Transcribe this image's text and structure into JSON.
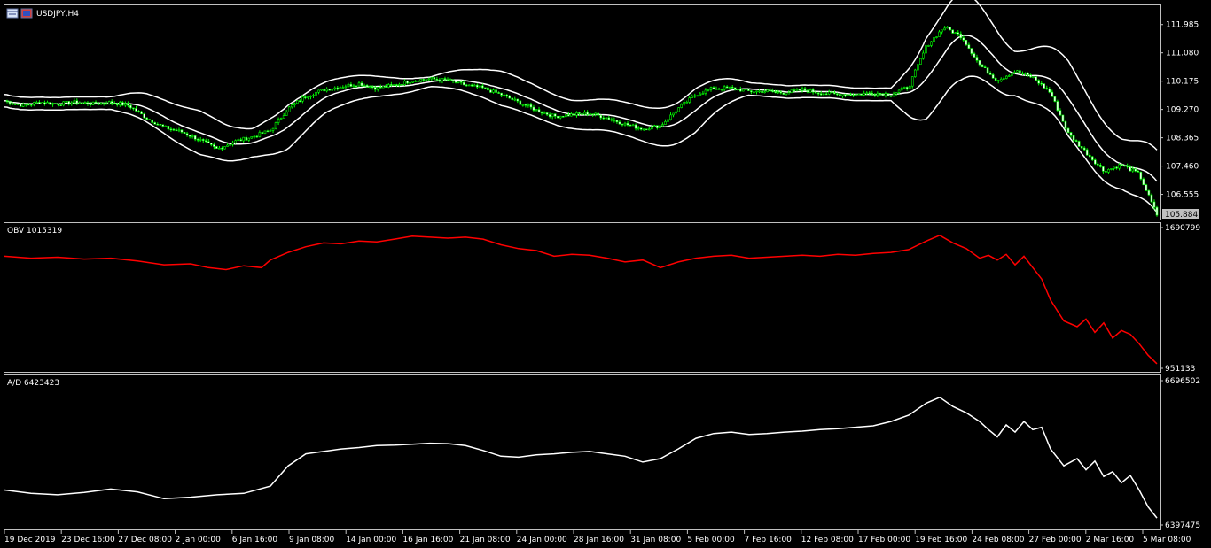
{
  "window": {
    "symbol_title": "USDJPY,H4",
    "icons": [
      "window-icon",
      "window-icon"
    ]
  },
  "colors": {
    "background": "#000000",
    "frame": "#c0c0c0",
    "candle_bull": "#00ff00",
    "candle_bear": "#ffffff",
    "bands": "#ffffff",
    "obv": "#ff0000",
    "ad": "#ffffff",
    "price_tag_bg": "#c0c0c0"
  },
  "chart_data": [
    {
      "type": "candlestick",
      "name": "USDJPY,H4",
      "title": "USDJPY,H4",
      "overlay": "bollinger-bands",
      "ylim": [
        105.75,
        112.6
      ],
      "yticks": [
        "111.985",
        "111.080",
        "110.175",
        "109.270",
        "108.365",
        "107.460",
        "106.555"
      ],
      "last_price": "105.884",
      "x_start": "19 Dec 2019",
      "x_end": "5 Mar 08:00",
      "close_anchors": [
        [
          0,
          109.55
        ],
        [
          20,
          109.4
        ],
        [
          40,
          109.5
        ],
        [
          60,
          109.45
        ],
        [
          80,
          109.5
        ],
        [
          100,
          109.45
        ],
        [
          120,
          109.5
        ],
        [
          140,
          109.4
        ],
        [
          160,
          109.0
        ],
        [
          180,
          108.7
        ],
        [
          200,
          108.55
        ],
        [
          220,
          108.3
        ],
        [
          240,
          108.0
        ],
        [
          260,
          108.25
        ],
        [
          280,
          108.4
        ],
        [
          300,
          108.6
        ],
        [
          320,
          109.3
        ],
        [
          340,
          109.7
        ],
        [
          360,
          109.9
        ],
        [
          380,
          110.0
        ],
        [
          400,
          110.1
        ],
        [
          420,
          109.95
        ],
        [
          440,
          110.05
        ],
        [
          460,
          110.2
        ],
        [
          480,
          110.25
        ],
        [
          500,
          110.2
        ],
        [
          520,
          110.05
        ],
        [
          540,
          109.95
        ],
        [
          560,
          109.75
        ],
        [
          580,
          109.5
        ],
        [
          600,
          109.25
        ],
        [
          620,
          109.05
        ],
        [
          640,
          109.1
        ],
        [
          660,
          109.15
        ],
        [
          680,
          109.0
        ],
        [
          700,
          108.8
        ],
        [
          720,
          108.65
        ],
        [
          740,
          108.75
        ],
        [
          760,
          109.3
        ],
        [
          780,
          109.75
        ],
        [
          800,
          109.95
        ],
        [
          820,
          109.95
        ],
        [
          840,
          109.85
        ],
        [
          860,
          109.85
        ],
        [
          880,
          109.8
        ],
        [
          900,
          109.9
        ],
        [
          920,
          109.8
        ],
        [
          940,
          109.75
        ],
        [
          960,
          109.75
        ],
        [
          980,
          109.8
        ],
        [
          1000,
          109.75
        ],
        [
          1020,
          110.0
        ],
        [
          1040,
          111.3
        ],
        [
          1060,
          111.9
        ],
        [
          1080,
          111.6
        ],
        [
          1100,
          110.7
        ],
        [
          1120,
          110.2
        ],
        [
          1140,
          110.5
        ],
        [
          1160,
          110.3
        ],
        [
          1180,
          109.8
        ],
        [
          1200,
          108.5
        ],
        [
          1220,
          107.9
        ],
        [
          1240,
          107.3
        ],
        [
          1260,
          107.5
        ],
        [
          1280,
          107.2
        ],
        [
          1300,
          105.9
        ]
      ],
      "bands_width_anchors": [
        [
          0,
          0.2
        ],
        [
          120,
          0.2
        ],
        [
          160,
          0.45
        ],
        [
          220,
          0.7
        ],
        [
          280,
          0.45
        ],
        [
          320,
          0.7
        ],
        [
          360,
          0.5
        ],
        [
          480,
          0.15
        ],
        [
          560,
          0.55
        ],
        [
          640,
          0.45
        ],
        [
          720,
          0.55
        ],
        [
          780,
          0.7
        ],
        [
          840,
          0.2
        ],
        [
          1000,
          0.2
        ],
        [
          1040,
          1.3
        ],
        [
          1080,
          1.4
        ],
        [
          1140,
          0.7
        ],
        [
          1200,
          1.2
        ],
        [
          1260,
          0.8
        ],
        [
          1300,
          1.0
        ]
      ]
    },
    {
      "type": "line",
      "name": "OBV",
      "title": "OBV 1015319",
      "ylim": [
        951133,
        1690799
      ],
      "yticks": [
        "1690799",
        "951133"
      ],
      "series": [
        {
          "name": "OBV",
          "x": [
            0,
            30,
            60,
            90,
            120,
            150,
            180,
            210,
            230,
            250,
            270,
            290,
            300,
            320,
            340,
            360,
            380,
            400,
            420,
            440,
            460,
            480,
            500,
            520,
            540,
            560,
            580,
            600,
            620,
            640,
            660,
            680,
            700,
            720,
            740,
            760,
            780,
            800,
            820,
            840,
            860,
            880,
            900,
            920,
            940,
            960,
            980,
            1000,
            1020,
            1040,
            1055,
            1070,
            1085,
            1100,
            1110,
            1120,
            1130,
            1140,
            1150,
            1160,
            1170,
            1180,
            1195,
            1210,
            1220,
            1230,
            1240,
            1250,
            1260,
            1270,
            1280,
            1290,
            1300
          ],
          "values": [
            1540000,
            1530000,
            1535000,
            1525000,
            1530000,
            1515000,
            1495000,
            1500000,
            1480000,
            1470000,
            1490000,
            1480000,
            1520000,
            1560000,
            1590000,
            1610000,
            1605000,
            1620000,
            1615000,
            1630000,
            1645000,
            1640000,
            1635000,
            1640000,
            1630000,
            1600000,
            1580000,
            1570000,
            1540000,
            1550000,
            1545000,
            1530000,
            1510000,
            1520000,
            1480000,
            1510000,
            1530000,
            1540000,
            1545000,
            1530000,
            1535000,
            1540000,
            1545000,
            1540000,
            1550000,
            1545000,
            1555000,
            1560000,
            1575000,
            1620000,
            1650000,
            1610000,
            1580000,
            1530000,
            1545000,
            1520000,
            1550000,
            1495000,
            1540000,
            1480000,
            1420000,
            1310000,
            1200000,
            1170000,
            1210000,
            1140000,
            1190000,
            1110000,
            1150000,
            1130000,
            1080000,
            1020000,
            975000
          ]
        }
      ]
    },
    {
      "type": "line",
      "name": "A/D",
      "title": "A/D 6423423",
      "ylim": [
        6397475,
        6696502
      ],
      "yticks": [
        "6696502",
        "6397475"
      ],
      "series": [
        {
          "name": "A/D",
          "x": [
            0,
            30,
            60,
            90,
            120,
            150,
            180,
            210,
            240,
            270,
            300,
            320,
            340,
            360,
            380,
            400,
            420,
            440,
            460,
            480,
            500,
            520,
            540,
            560,
            580,
            600,
            620,
            640,
            660,
            680,
            700,
            720,
            740,
            760,
            780,
            800,
            820,
            840,
            860,
            880,
            900,
            920,
            940,
            960,
            980,
            1000,
            1020,
            1040,
            1055,
            1070,
            1085,
            1100,
            1110,
            1120,
            1130,
            1140,
            1150,
            1160,
            1170,
            1180,
            1195,
            1210,
            1220,
            1230,
            1240,
            1250,
            1260,
            1270,
            1280,
            1290,
            1300
          ],
          "values": [
            6470000,
            6463000,
            6460000,
            6465000,
            6472000,
            6466000,
            6452000,
            6455000,
            6460000,
            6463000,
            6478000,
            6520000,
            6545000,
            6550000,
            6555000,
            6558000,
            6562000,
            6563000,
            6565000,
            6567000,
            6566000,
            6562000,
            6552000,
            6540000,
            6538000,
            6543000,
            6545000,
            6548000,
            6550000,
            6545000,
            6540000,
            6528000,
            6535000,
            6555000,
            6577000,
            6587000,
            6590000,
            6585000,
            6587000,
            6590000,
            6592000,
            6595000,
            6597000,
            6600000,
            6603000,
            6612000,
            6625000,
            6650000,
            6662000,
            6643000,
            6630000,
            6612000,
            6595000,
            6580000,
            6605000,
            6590000,
            6612000,
            6595000,
            6600000,
            6555000,
            6520000,
            6535000,
            6512000,
            6530000,
            6498000,
            6508000,
            6485000,
            6500000,
            6470000,
            6435000,
            6412000
          ]
        }
      ]
    }
  ],
  "x_axis": {
    "labels": [
      "19 Dec 2019",
      "23 Dec 16:00",
      "27 Dec 08:00",
      "2 Jan 00:00",
      "6 Jan 16:00",
      "9 Jan 08:00",
      "14 Jan 00:00",
      "16 Jan 16:00",
      "21 Jan 08:00",
      "24 Jan 00:00",
      "28 Jan 16:00",
      "31 Jan 08:00",
      "5 Feb 00:00",
      "7 Feb 16:00",
      "12 Feb 08:00",
      "17 Feb 00:00",
      "19 Feb 16:00",
      "24 Feb 08:00",
      "27 Feb 00:00",
      "2 Mar 16:00",
      "5 Mar 08:00"
    ]
  }
}
